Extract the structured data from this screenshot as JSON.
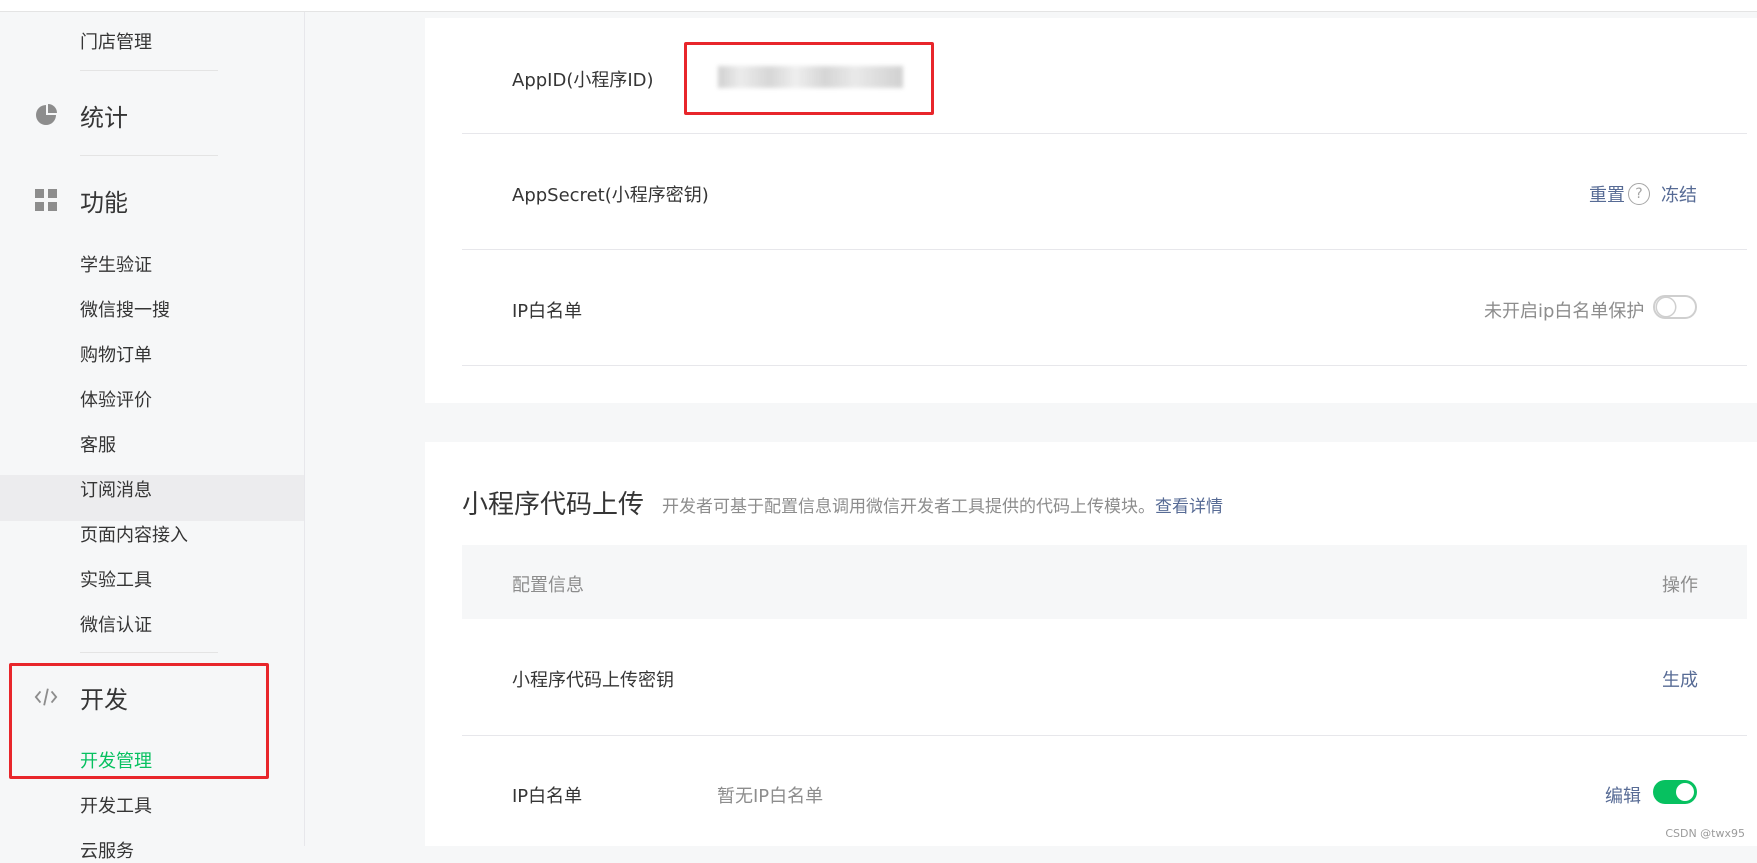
{
  "sidebar": {
    "top_item": "门店管理",
    "groups": {
      "stats": {
        "label": "统计",
        "icon": "pie-chart-icon"
      },
      "features": {
        "label": "功能",
        "icon": "grid-icon"
      },
      "dev": {
        "label": "开发",
        "icon": "code-icon"
      }
    },
    "feature_items": [
      "学生验证",
      "微信搜一搜",
      "购物订单",
      "体验评价",
      "客服",
      "订阅消息",
      "页面内容接入",
      "实验工具",
      "微信认证"
    ],
    "dev_items": [
      "开发管理",
      "开发工具",
      "云服务"
    ]
  },
  "account": {
    "appid_label": "AppID(小程序ID)",
    "appsecret_label": "AppSecret(小程序密钥)",
    "reset_link": "重置",
    "freeze_link": "冻结",
    "ip_whitelist_label": "IP白名单",
    "ip_protect_status": "未开启ip白名单保护"
  },
  "upload": {
    "title": "小程序代码上传",
    "description": "开发者可基于配置信息调用微信开发者工具提供的代码上传模块。",
    "details_link": "查看详情",
    "col_config": "配置信息",
    "col_action": "操作",
    "key_label": "小程序代码上传密钥",
    "generate_link": "生成",
    "ip_label": "IP白名单",
    "ip_value": "暂无IP白名单",
    "edit_link": "编辑"
  },
  "watermark": "CSDN @twx95",
  "colors": {
    "accent_green": "#07c160",
    "link_blue": "#576b95",
    "annotation_red": "#e8262b"
  }
}
